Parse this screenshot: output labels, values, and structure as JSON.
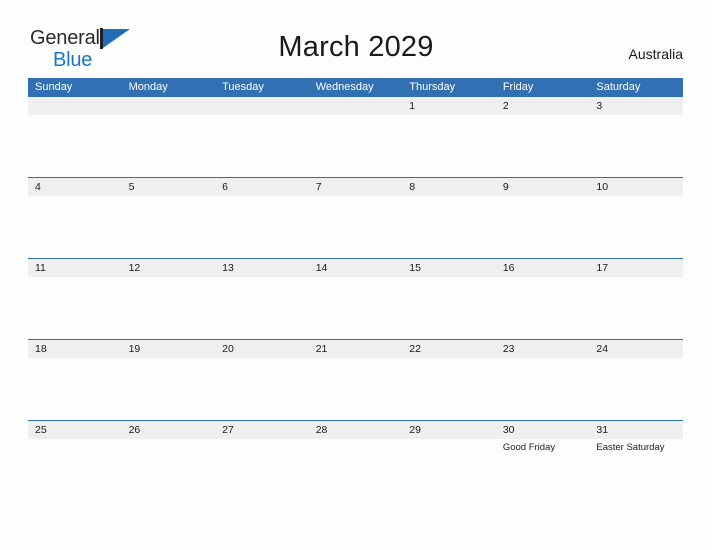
{
  "brand": {
    "name_part1": "General",
    "name_part2": "Blue",
    "logo_icon": "flag-triangle-icon",
    "color_primary": "#1c76c8",
    "color_pole": "#222222"
  },
  "header": {
    "title": "March 2029",
    "region": "Australia"
  },
  "theme": {
    "header_blue": "#3070b3",
    "rule_blue": "#2f6fb0",
    "date_strip_gray": "#efefef",
    "page_background": "#fdfdfd",
    "text_dark": "#1a1a1a"
  },
  "calendar": {
    "month": "March",
    "year": "2029",
    "weekday_headers": [
      "Sunday",
      "Monday",
      "Tuesday",
      "Wednesday",
      "Thursday",
      "Friday",
      "Saturday"
    ],
    "weeks": [
      {
        "days": [
          {
            "date": "",
            "events": []
          },
          {
            "date": "",
            "events": []
          },
          {
            "date": "",
            "events": []
          },
          {
            "date": "",
            "events": []
          },
          {
            "date": "1",
            "events": []
          },
          {
            "date": "2",
            "events": []
          },
          {
            "date": "3",
            "events": []
          }
        ]
      },
      {
        "days": [
          {
            "date": "4",
            "events": []
          },
          {
            "date": "5",
            "events": []
          },
          {
            "date": "6",
            "events": []
          },
          {
            "date": "7",
            "events": []
          },
          {
            "date": "8",
            "events": []
          },
          {
            "date": "9",
            "events": []
          },
          {
            "date": "10",
            "events": []
          }
        ]
      },
      {
        "days": [
          {
            "date": "11",
            "events": []
          },
          {
            "date": "12",
            "events": []
          },
          {
            "date": "13",
            "events": []
          },
          {
            "date": "14",
            "events": []
          },
          {
            "date": "15",
            "events": []
          },
          {
            "date": "16",
            "events": []
          },
          {
            "date": "17",
            "events": []
          }
        ]
      },
      {
        "days": [
          {
            "date": "18",
            "events": []
          },
          {
            "date": "19",
            "events": []
          },
          {
            "date": "20",
            "events": []
          },
          {
            "date": "21",
            "events": []
          },
          {
            "date": "22",
            "events": []
          },
          {
            "date": "23",
            "events": []
          },
          {
            "date": "24",
            "events": []
          }
        ]
      },
      {
        "days": [
          {
            "date": "25",
            "events": []
          },
          {
            "date": "26",
            "events": []
          },
          {
            "date": "27",
            "events": []
          },
          {
            "date": "28",
            "events": []
          },
          {
            "date": "29",
            "events": []
          },
          {
            "date": "30",
            "events": [
              "Good Friday"
            ]
          },
          {
            "date": "31",
            "events": [
              "Easter Saturday"
            ]
          }
        ]
      }
    ]
  }
}
